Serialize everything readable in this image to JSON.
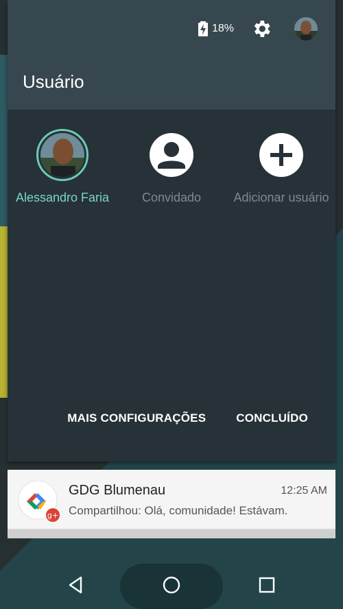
{
  "status": {
    "battery": "18%"
  },
  "panel": {
    "title": "Usuário"
  },
  "users": [
    {
      "label": "Alessandro Faria",
      "active": true
    },
    {
      "label": "Convidado",
      "active": false
    },
    {
      "label": "Adicionar usuário",
      "active": false
    }
  ],
  "actions": {
    "more_settings": "MAIS CONFIGURAÇÕES",
    "done": "CONCLUÍDO"
  },
  "notification": {
    "title": "GDG Blumenau",
    "time": "12:25 AM",
    "text": "Compartilhou: Olá, comunidade!  Estávam."
  },
  "colors": {
    "accent": "#7ed3c5",
    "panel_bg": "#263238",
    "header_bg": "#37474f"
  }
}
